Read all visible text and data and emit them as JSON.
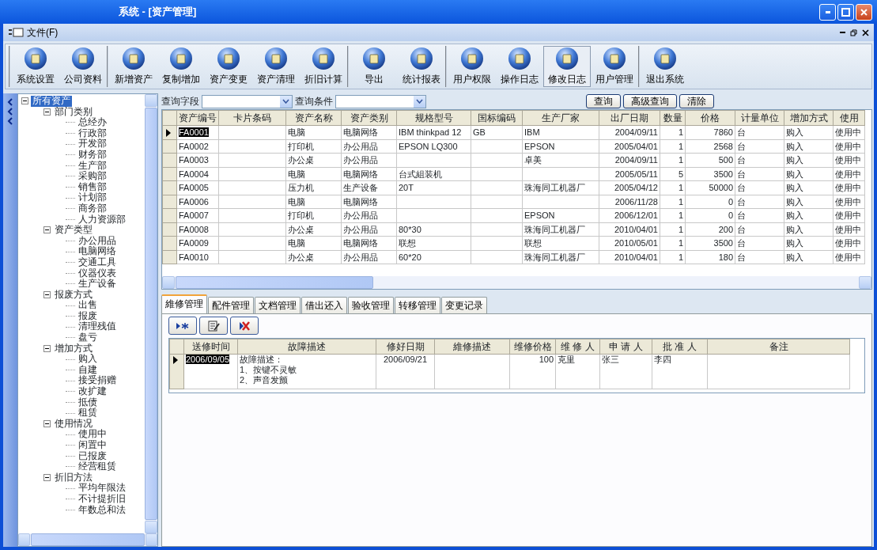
{
  "window": {
    "title": "系统 - [资产管理]"
  },
  "menu": [
    {
      "label": "文件(F)"
    }
  ],
  "toolbar_groups": [
    {
      "buttons": [
        {
          "label": "系统设置",
          "selected": false
        },
        {
          "label": "公司资料",
          "selected": false
        }
      ]
    },
    {
      "buttons": [
        {
          "label": "新增资产",
          "selected": false
        },
        {
          "label": "复制增加",
          "selected": false
        },
        {
          "label": "资产变更",
          "selected": false
        },
        {
          "label": "资产清理",
          "selected": false
        },
        {
          "label": "折旧计算",
          "selected": false
        }
      ]
    },
    {
      "buttons": [
        {
          "label": "导出",
          "selected": false
        },
        {
          "label": "统计报表",
          "selected": false
        }
      ]
    },
    {
      "buttons": [
        {
          "label": "用户权限",
          "selected": false
        },
        {
          "label": "操作日志",
          "selected": false
        },
        {
          "label": "修改日志",
          "selected": true
        },
        {
          "label": "用户管理",
          "selected": false
        }
      ]
    },
    {
      "buttons": [
        {
          "label": "退出系统",
          "selected": false
        }
      ]
    }
  ],
  "tree": {
    "label": "所有资产",
    "selected": true,
    "expanded": true,
    "children": [
      {
        "label": "部门类别",
        "selected": false,
        "expanded": true,
        "children": [
          {
            "label": "总经办",
            "selected": false
          },
          {
            "label": "行政部",
            "selected": false
          },
          {
            "label": "开发部",
            "selected": false
          },
          {
            "label": "财务部",
            "selected": false
          },
          {
            "label": "生产部",
            "selected": false
          },
          {
            "label": "采购部",
            "selected": false
          },
          {
            "label": "销售部",
            "selected": false
          },
          {
            "label": "计划部",
            "selected": false
          },
          {
            "label": "商务部",
            "selected": false
          },
          {
            "label": "人力资源部",
            "selected": false
          }
        ]
      },
      {
        "label": "资产类型",
        "selected": false,
        "expanded": true,
        "children": [
          {
            "label": "办公用品",
            "selected": false
          },
          {
            "label": "电脑网络",
            "selected": false
          },
          {
            "label": "交通工具",
            "selected": false
          },
          {
            "label": "仪器仪表",
            "selected": false
          },
          {
            "label": "生产设备",
            "selected": false
          }
        ]
      },
      {
        "label": "报废方式",
        "selected": false,
        "expanded": true,
        "children": [
          {
            "label": "出售",
            "selected": false
          },
          {
            "label": "报废",
            "selected": false
          },
          {
            "label": "清理残值",
            "selected": false
          },
          {
            "label": "盘亏",
            "selected": false
          }
        ]
      },
      {
        "label": "增加方式",
        "selected": false,
        "expanded": true,
        "children": [
          {
            "label": "购入",
            "selected": false
          },
          {
            "label": "自建",
            "selected": false
          },
          {
            "label": "接受捐赠",
            "selected": false
          },
          {
            "label": "改扩建",
            "selected": false
          },
          {
            "label": "抵债",
            "selected": false
          },
          {
            "label": "租赁",
            "selected": false
          }
        ]
      },
      {
        "label": "使用情况",
        "selected": false,
        "expanded": true,
        "children": [
          {
            "label": "使用中",
            "selected": false
          },
          {
            "label": "闲置中",
            "selected": false
          },
          {
            "label": "已报废",
            "selected": false
          },
          {
            "label": "经营租赁",
            "selected": false
          }
        ]
      },
      {
        "label": "折旧方法",
        "selected": false,
        "expanded": true,
        "children": [
          {
            "label": "平均年限法",
            "selected": false
          },
          {
            "label": "不计提折旧",
            "selected": false
          },
          {
            "label": "年数总和法",
            "selected": false
          }
        ]
      }
    ]
  },
  "query": {
    "field_label": "查询字段",
    "condition_label": "查询条件",
    "buttons": [
      "查询",
      "高级查询",
      "清除"
    ]
  },
  "table": {
    "columns": [
      {
        "label": "资产编号",
        "kind": "text"
      },
      {
        "label": "卡片条码",
        "kind": "text"
      },
      {
        "label": "资产名称",
        "kind": "text"
      },
      {
        "label": "资产类别",
        "kind": "text"
      },
      {
        "label": "规格型号",
        "kind": "text"
      },
      {
        "label": "国标编码",
        "kind": "text"
      },
      {
        "label": "生产厂家",
        "kind": "text"
      },
      {
        "label": "出厂日期",
        "kind": "number"
      },
      {
        "label": "数量",
        "kind": "number"
      },
      {
        "label": "价格",
        "kind": "number"
      },
      {
        "label": "计量单位",
        "kind": "text"
      },
      {
        "label": "增加方式",
        "kind": "text"
      },
      {
        "label": "使用",
        "kind": "text"
      }
    ],
    "rows": [
      {
        "current": true,
        "cells": [
          "FA0001",
          null,
          "电脑",
          "电脑网络",
          "IBM thinkpad 12",
          "GB",
          "IBM",
          "2004/09/11",
          "1",
          "7860",
          "台",
          "购入",
          "使用中"
        ]
      },
      {
        "current": false,
        "cells": [
          "FA0002",
          null,
          "打印机",
          "办公用品",
          "EPSON LQ300",
          null,
          "EPSON",
          "2005/04/01",
          "1",
          "2568",
          "台",
          "购入",
          "使用中"
        ]
      },
      {
        "current": false,
        "cells": [
          "FA0003",
          null,
          "办公桌",
          "办公用品",
          null,
          null,
          "卓美",
          "2004/09/11",
          "1",
          "500",
          "台",
          "购入",
          "使用中"
        ]
      },
      {
        "current": false,
        "cells": [
          "FA0004",
          null,
          "电脑",
          "电脑网络",
          "台式組装机",
          null,
          null,
          "2005/05/11",
          "5",
          "3500",
          "台",
          "购入",
          "使用中"
        ]
      },
      {
        "current": false,
        "cells": [
          "FA0005",
          null,
          "压力机",
          "生产设备",
          "20T",
          null,
          "珠海同工机器厂",
          "2005/04/12",
          "1",
          "50000",
          "台",
          "购入",
          "使用中"
        ]
      },
      {
        "current": false,
        "cells": [
          "FA0006",
          null,
          "电脑",
          "电脑网络",
          null,
          null,
          null,
          "2006/11/28",
          "1",
          "0",
          "台",
          "购入",
          "使用中"
        ]
      },
      {
        "current": false,
        "cells": [
          "FA0007",
          null,
          "打印机",
          "办公用品",
          null,
          null,
          "EPSON",
          "2006/12/01",
          "1",
          "0",
          "台",
          "购入",
          "使用中"
        ]
      },
      {
        "current": false,
        "cells": [
          "FA0008",
          null,
          "办公桌",
          "办公用品",
          "80*30",
          null,
          "珠海同工机器厂",
          "2010/04/01",
          "1",
          "200",
          "台",
          "购入",
          "使用中"
        ]
      },
      {
        "current": false,
        "cells": [
          "FA0009",
          null,
          "电脑",
          "电脑网络",
          "联想",
          null,
          "联想",
          "2010/05/01",
          "1",
          "3500",
          "台",
          "购入",
          "使用中"
        ]
      },
      {
        "current": false,
        "cells": [
          "FA0010",
          null,
          "办公桌",
          "办公用品",
          "60*20",
          null,
          "珠海同工机器厂",
          "2010/04/01",
          "1",
          "180",
          "台",
          "购入",
          "使用中"
        ]
      }
    ]
  },
  "tabs": [
    {
      "label": "維修管理",
      "selected": true
    },
    {
      "label": "配件管理",
      "selected": false
    },
    {
      "label": "文档管理",
      "selected": false
    },
    {
      "label": "借出还入",
      "selected": false
    },
    {
      "label": "验收管理",
      "selected": false
    },
    {
      "label": "转移管理",
      "selected": false
    },
    {
      "label": "变更记录",
      "selected": false
    }
  ],
  "repair_table": {
    "columns": [
      {
        "label": "送修时间",
        "kind": "text"
      },
      {
        "label": "故障描述",
        "kind": "text"
      },
      {
        "label": "修好日期",
        "kind": "center"
      },
      {
        "label": "維修描述",
        "kind": "text"
      },
      {
        "label": "维修价格",
        "kind": "number"
      },
      {
        "label": "维 修 人",
        "kind": "text"
      },
      {
        "label": "申 请 人",
        "kind": "text"
      },
      {
        "label": "批 准 人",
        "kind": "text"
      },
      {
        "label": "备注",
        "kind": "text"
      }
    ],
    "rows": [
      {
        "current": true,
        "cells": [
          "2006/09/05",
          "故障描述：\n1、按键不灵敏\n2、声音发颤",
          "2006/09/21",
          null,
          "100",
          "克里",
          "张三",
          "李四",
          null
        ]
      }
    ]
  }
}
